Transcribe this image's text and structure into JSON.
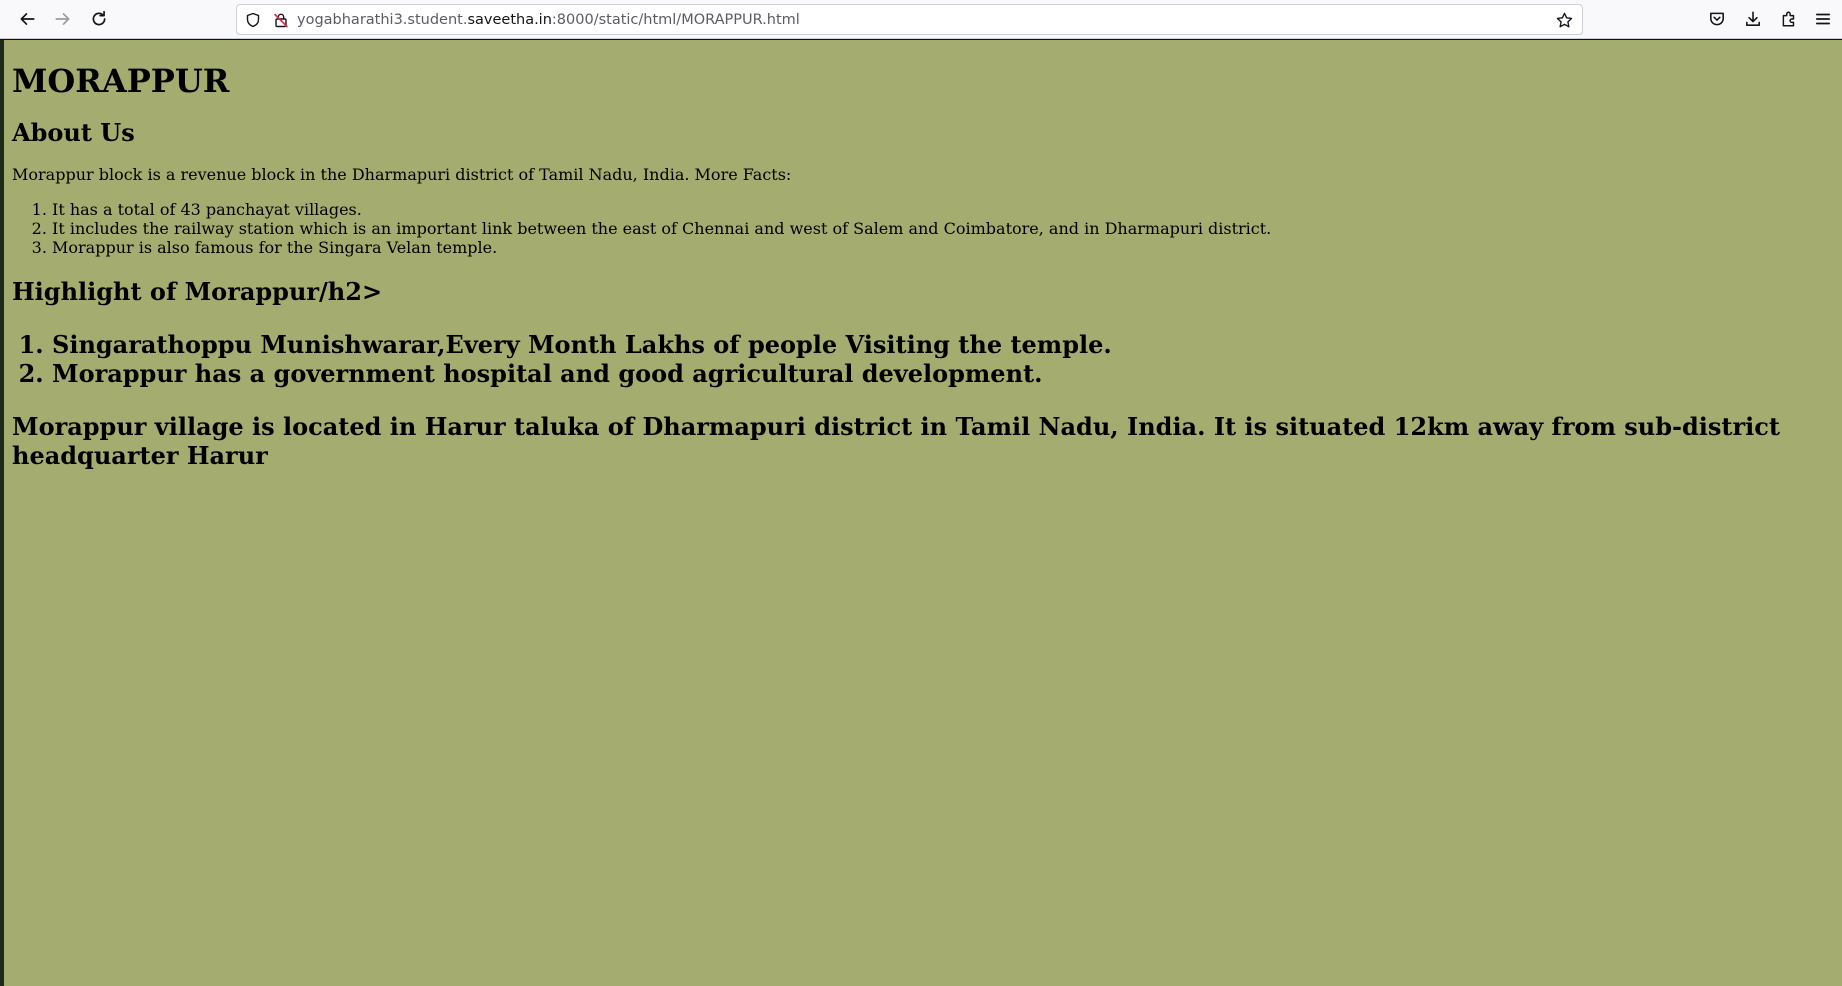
{
  "browser": {
    "url": {
      "prefix": "yogabharathi3.student.",
      "host": "saveetha.in",
      "suffix": ":8000/static/html/MORAPPUR.html"
    },
    "icons": {
      "back": "back-arrow-icon",
      "forward": "forward-arrow-icon",
      "reload": "reload-icon",
      "shield": "tracking-protection-shield-icon",
      "lock": "insecure-lock-icon",
      "bookmark": "bookmark-star-icon",
      "pocket": "pocket-icon",
      "downloads": "download-icon",
      "extensions": "extensions-puzzle-icon",
      "menu": "hamburger-menu-icon"
    }
  },
  "colors": {
    "page_background": "#a4ad6f",
    "toolbar_background": "#f9f9fb",
    "text": "#000000"
  },
  "page": {
    "title": "MORAPPUR",
    "about_heading": "About Us",
    "intro": "Morappur block is a revenue block in the Dharmapuri district of Tamil Nadu, India. More Facts:",
    "facts": [
      "It has a total of 43 panchayat villages.",
      "It includes the railway station which is an important link between the east of Chennai and west of Salem and Coimbatore, and in Dharmapuri district.",
      "Morappur is also famous for the Singara Velan temple."
    ],
    "highlight_heading": "Highlight of Morappur/h2>",
    "highlights": [
      "Singarathoppu Munishwarar,Every Month Lakhs of people Visiting the temple.",
      "Morappur has a government hospital and good agricultural development."
    ],
    "location": "Morappur village is located in Harur taluka of Dharmapuri district in Tamil Nadu, India. It is situated 12km away from sub-district headquarter Harur"
  }
}
